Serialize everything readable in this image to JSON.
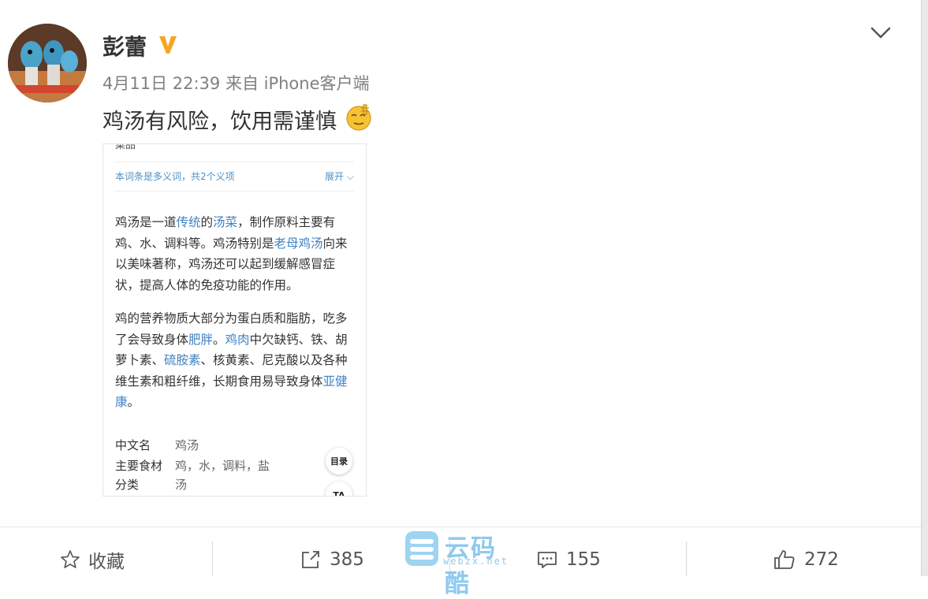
{
  "post": {
    "author": "彭蕾",
    "meta": "4月11日 22:39 来自 iPhone客户端",
    "text": "鸡汤有风险，饮用需谨慎"
  },
  "screenshot": {
    "top_label": "菜品",
    "polysemy_note": "本词条是多义词，共2个义项",
    "expand_label": "展开",
    "para1": [
      {
        "t": "鸡汤是一道"
      },
      {
        "t": "传统",
        "link": true
      },
      {
        "t": "的"
      },
      {
        "t": "汤菜",
        "link": true
      },
      {
        "t": "，制作原料主要有鸡、水、调料等。鸡汤特别是"
      },
      {
        "t": "老母鸡汤",
        "link": true
      },
      {
        "t": "向来以美味著称，鸡汤还可以起到缓解感冒症状，提高人体的免疫功能的作用。"
      }
    ],
    "para2": [
      {
        "t": "鸡的营养物质大部分为蛋白质和脂肪，吃多了会导致身体"
      },
      {
        "t": "肥胖",
        "link": true
      },
      {
        "t": "。"
      },
      {
        "t": "鸡肉",
        "link": true
      },
      {
        "t": "中欠缺钙、铁、胡萝卜素、"
      },
      {
        "t": "硫胺素",
        "link": true
      },
      {
        "t": "、核黄素、尼克酸以及各种维生素和粗纤维，长期食用易导致身体"
      },
      {
        "t": "亚健康",
        "link": true
      },
      {
        "t": "。"
      }
    ],
    "info": [
      {
        "key": "中文名",
        "value": "鸡汤"
      },
      {
        "key": "主要食材",
        "value": "鸡，水，调料，盐"
      },
      {
        "key": "分类",
        "value": "汤"
      }
    ],
    "toc_label": "目录",
    "ta_label": "TA"
  },
  "actions": {
    "favorite": "收藏",
    "repost_count": "385",
    "comment_count": "155",
    "like_count": "272"
  },
  "watermark": {
    "title": "云码酷",
    "domain": "webzx.net"
  },
  "colors": {
    "link": "#3f82c4",
    "verified_badge": "#f5a623",
    "watermark": "#8fc9ee"
  },
  "icons": [
    "chevron-down-icon",
    "verified-icon",
    "emoji-icon",
    "star-icon",
    "repost-icon",
    "comment-icon",
    "thumbs-up-icon"
  ]
}
